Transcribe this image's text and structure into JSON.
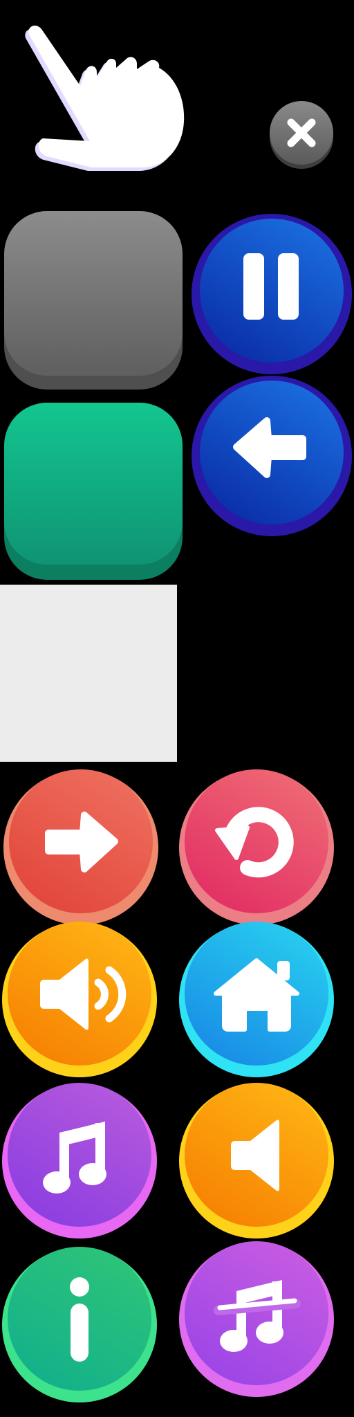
{
  "sheet": {
    "title": "",
    "background": "#000000"
  },
  "pointer": {
    "icon": "pointing-hand-icon",
    "fill": "#ffffff",
    "outline": "#e4d9ff"
  },
  "close_button": {
    "icon": "close-icon",
    "label": "",
    "colors": {
      "top": "#8a8a8a",
      "bottom": "#4a4a4a",
      "glyph": "#ffffff"
    }
  },
  "square_buttons": [
    {
      "id": "gray",
      "label": "",
      "colors": {
        "top": "#8a8a8a",
        "bottom": "#5e5e5e",
        "base": "#4f4f4f"
      }
    },
    {
      "id": "green",
      "label": "",
      "colors": {
        "top": "#13c58f",
        "bottom": "#0f9a74",
        "base": "#0c7f61"
      }
    }
  ],
  "blue_buttons": [
    {
      "icon": "pause-icon",
      "label": "",
      "colors": {
        "top": "#1565d8",
        "bottom": "#0a2fa8",
        "ring": "#2a18a8",
        "glyph": "#ffffff"
      }
    },
    {
      "icon": "arrow-left-icon",
      "label": "",
      "colors": {
        "top": "#1565d8",
        "bottom": "#0a2fa8",
        "ring": "#2a18a8",
        "glyph": "#ffffff"
      }
    }
  ],
  "light_panel": {
    "color": "#ececec"
  },
  "round_buttons": [
    {
      "icon": "arrow-right-icon",
      "label": "",
      "colors": {
        "top": "#ee6a55",
        "bottom": "#e24a3c",
        "base": "#ee8a6e",
        "glyph": "#ffffff"
      }
    },
    {
      "icon": "replay-icon",
      "label": "",
      "colors": {
        "top": "#ef5f6f",
        "bottom": "#e23566",
        "base": "#ec7f86",
        "glyph": "#ffffff"
      }
    },
    {
      "icon": "sound-on-icon",
      "label": "",
      "colors": {
        "top": "#ffae12",
        "bottom": "#f78402",
        "base": "#ffd21a",
        "glyph": "#ffffff"
      }
    },
    {
      "icon": "home-icon",
      "label": "",
      "colors": {
        "top": "#26c9ee",
        "bottom": "#1a8fe8",
        "base": "#2fe2f4",
        "glyph": "#ffffff"
      }
    },
    {
      "icon": "music-icon",
      "label": "",
      "colors": {
        "top": "#b055df",
        "bottom": "#8a3fe0",
        "base": "#e868f4",
        "glyph": "#ffffff"
      }
    },
    {
      "icon": "sound-off-icon",
      "label": "",
      "colors": {
        "top": "#ffae12",
        "bottom": "#f78402",
        "base": "#ffd21a",
        "glyph": "#ffffff"
      }
    },
    {
      "icon": "info-icon",
      "label": "",
      "colors": {
        "top": "#2ec47a",
        "bottom": "#12b48a",
        "base": "#3de38c",
        "glyph": "#ffffff"
      }
    },
    {
      "icon": "music-off-icon",
      "label": "",
      "colors": {
        "top": "#c45ae6",
        "bottom": "#9a45e6",
        "base": "#e06cf0",
        "glyph": "#ffffff"
      }
    }
  ]
}
